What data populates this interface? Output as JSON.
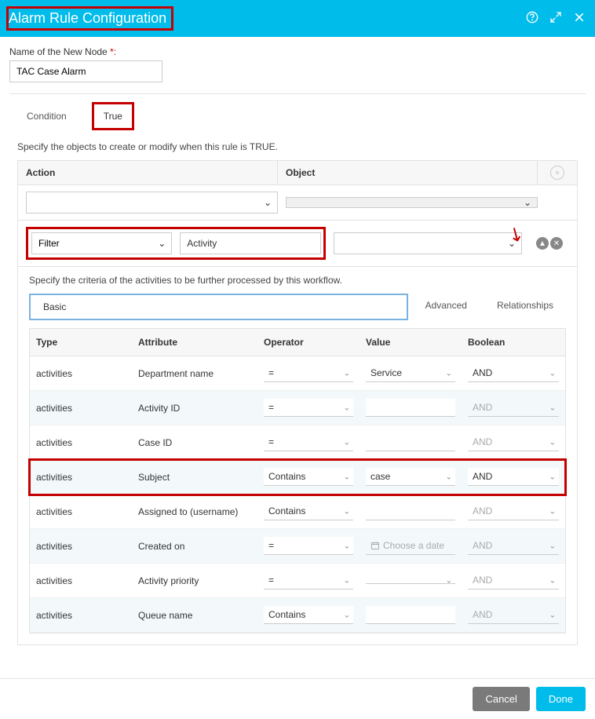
{
  "header": {
    "title": "Alarm Rule Configuration"
  },
  "nodeName": {
    "label": "Name of the New Node",
    "required": "*:",
    "value": "TAC Case Alarm"
  },
  "tabs": {
    "condition": "Condition",
    "true": "True"
  },
  "instruction": "Specify the objects to create or modify when this rule is TRUE.",
  "panelHead": {
    "action": "Action",
    "object": "Object"
  },
  "actionRow": {
    "filter": "Filter",
    "activity": "Activity"
  },
  "subInstruction": "Specify the criteria of the activities to be further processed by this workflow.",
  "subTabs": {
    "basic": "Basic",
    "advanced": "Advanced",
    "relationships": "Relationships"
  },
  "table": {
    "headers": {
      "type": "Type",
      "attribute": "Attribute",
      "operator": "Operator",
      "value": "Value",
      "boolean": "Boolean"
    },
    "rows": [
      {
        "type": "activities",
        "attribute": "Department name",
        "operator": "=",
        "value": "Service",
        "boolean": "AND",
        "boolDis": false
      },
      {
        "type": "activities",
        "attribute": "Activity ID",
        "operator": "=",
        "value": "",
        "boolean": "AND",
        "boolDis": true
      },
      {
        "type": "activities",
        "attribute": "Case ID",
        "operator": "=",
        "value": "",
        "boolean": "AND",
        "boolDis": true
      },
      {
        "type": "activities",
        "attribute": "Subject",
        "operator": "Contains",
        "value": "case",
        "boolean": "AND",
        "boolDis": false,
        "hl": true
      },
      {
        "type": "activities",
        "attribute": "Assigned to (username)",
        "operator": "Contains",
        "value": "",
        "boolean": "AND",
        "boolDis": true
      },
      {
        "type": "activities",
        "attribute": "Created on",
        "operator": "=",
        "value": "",
        "boolean": "AND",
        "boolDis": true,
        "date": true,
        "datePlaceholder": "Choose a date"
      },
      {
        "type": "activities",
        "attribute": "Activity priority",
        "operator": "=",
        "value": "",
        "boolean": "AND",
        "boolDis": true,
        "valSel": true
      },
      {
        "type": "activities",
        "attribute": "Queue name",
        "operator": "Contains",
        "value": "",
        "boolean": "AND",
        "boolDis": true
      }
    ]
  },
  "footer": {
    "cancel": "Cancel",
    "done": "Done"
  }
}
